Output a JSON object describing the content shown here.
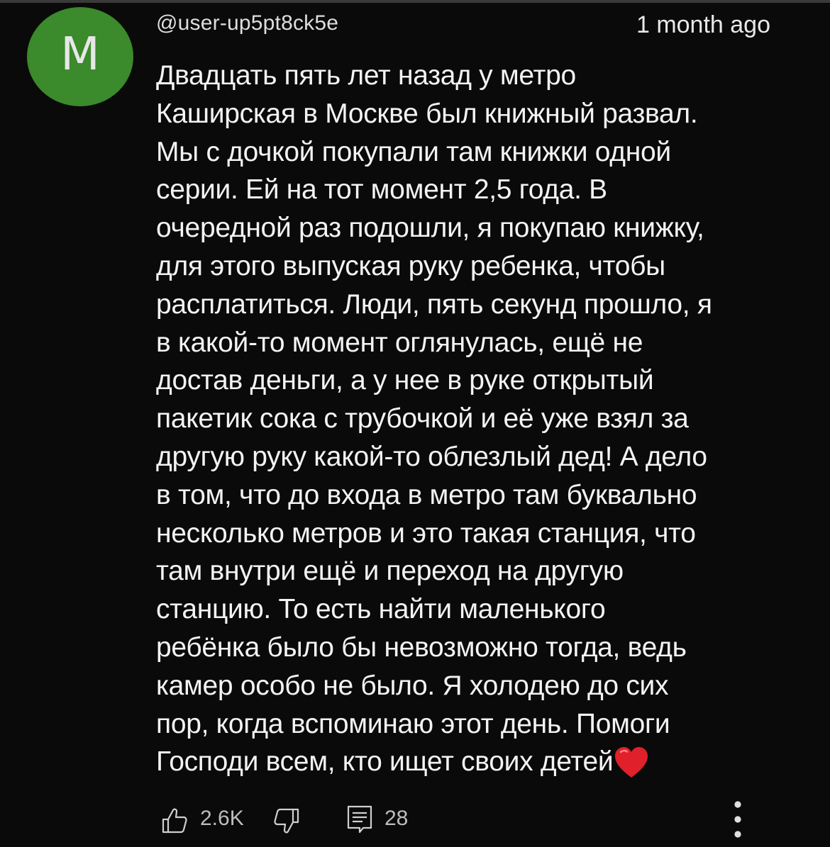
{
  "comment": {
    "avatar_letter": "M",
    "avatar_color": "#3b8a2b",
    "author": "@user-up5pt8ck5e",
    "time": "1 month ago",
    "text": "Двадцать пять лет назад у метро\nКаширская в Москве был книжный развал.\nМы с дочкой покупали там книжки одной\nсерии. Ей на тот момент 2,5 года. В\nочередной раз подошли, я покупаю книжку,\nдля этого выпуская руку ребенка, чтобы\nрасплатиться. Люди, пять секунд прошло, я\nв какой-то момент оглянулась, ещё не\nдостав деньги, а у нее в руке открытый\nпакетик сока с трубочкой и её уже взял за\nдругую руку какой-то облезлый дед! А дело\nв том, что до входа в метро там буквально\nнесколько метров и это такая станция, что\nтам внутри ещё и переход на другую\nстанцию. То есть найти маленького\nребёнка было бы невозможно тогда, ведь\nкамер особо не было. Я холодею до сих\nпор, когда вспоминаю этот день. Помоги\nГосподи всем, кто ищет своих детей",
    "emoji": "red-heart",
    "likes": "2.6K",
    "replies": "28"
  },
  "icons": {
    "like": "thumb-up-icon",
    "dislike": "thumb-down-icon",
    "reply": "reply-icon",
    "more": "more-vertical-icon"
  },
  "colors": {
    "background": "#0a0a0a",
    "text": "#f3f3f3",
    "secondary_text": "#bdbdbd",
    "heart": "#e0202a"
  }
}
